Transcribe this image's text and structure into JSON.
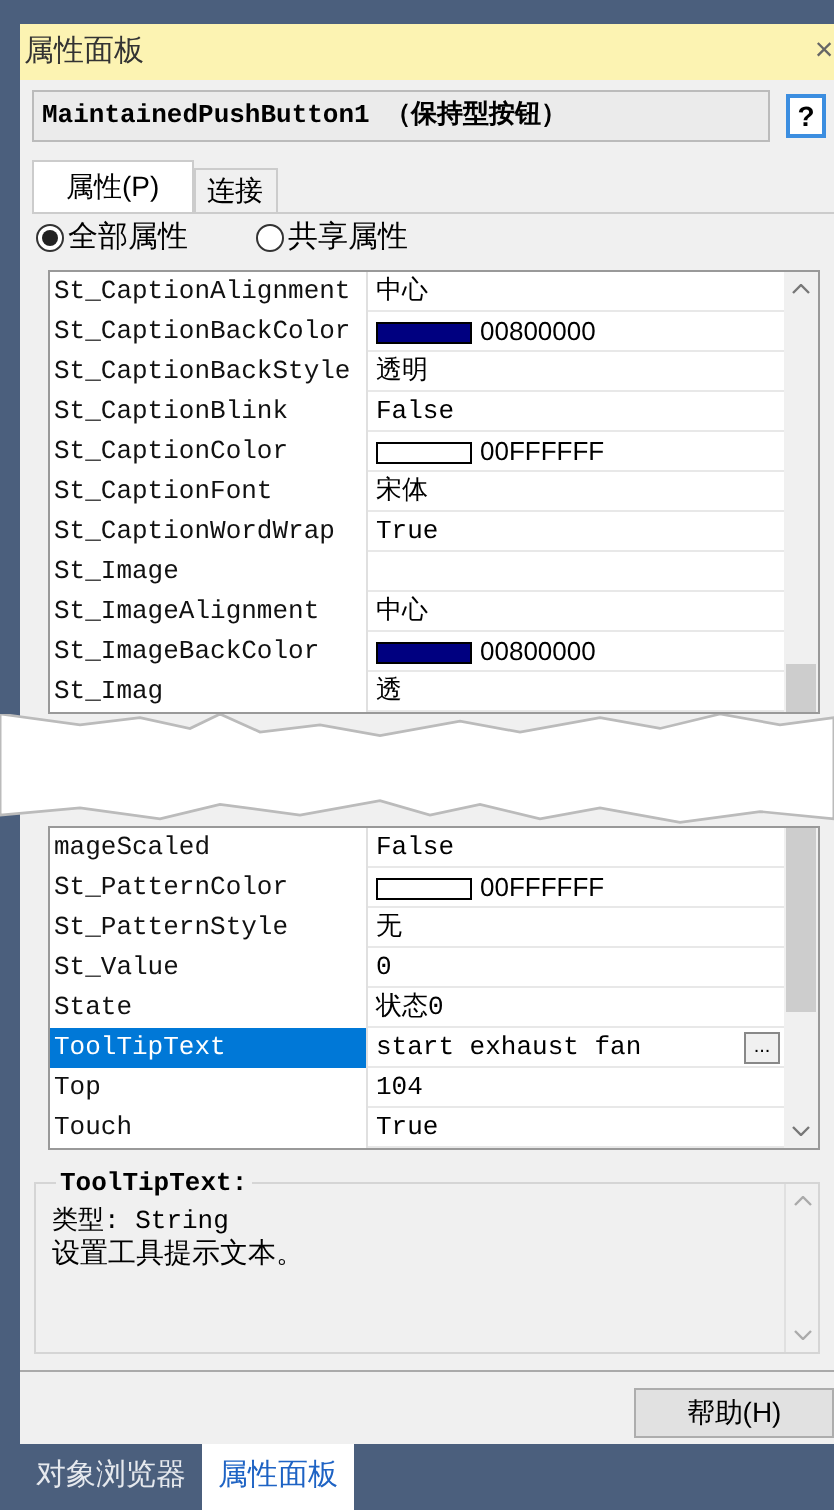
{
  "window": {
    "title": "属性面板",
    "close": "×"
  },
  "object": {
    "label": "MaintainedPushButton1 （保持型按钮）",
    "help": "?"
  },
  "tabs": [
    {
      "label": "属性(P)",
      "selected": true
    },
    {
      "label": "连接",
      "selected": false
    }
  ],
  "filters": [
    {
      "label": "全部属性",
      "selected": true
    },
    {
      "label": "共享属性",
      "selected": false
    }
  ],
  "grid": {
    "upper_rows": [
      {
        "name": "St_CaptionAlignment",
        "kind": "text",
        "value": "中心",
        "selected": false
      },
      {
        "name": "St_CaptionBackColor",
        "kind": "color",
        "color": "#000080",
        "value": "00800000",
        "selected": false
      },
      {
        "name": "St_CaptionBackStyle",
        "kind": "text",
        "value": "透明",
        "selected": false
      },
      {
        "name": "St_CaptionBlink",
        "kind": "text",
        "value": "False",
        "selected": false
      },
      {
        "name": "St_CaptionColor",
        "kind": "color",
        "color": "#ffffff",
        "value": "00FFFFFF",
        "selected": false
      },
      {
        "name": "St_CaptionFont",
        "kind": "text",
        "value": "宋体",
        "selected": false
      },
      {
        "name": "St_CaptionWordWrap",
        "kind": "text",
        "value": "True",
        "selected": false
      },
      {
        "name": "St_Image",
        "kind": "text",
        "selected": false
      },
      {
        "name": "St_ImageAlignment",
        "kind": "text",
        "value": "中心",
        "selected": false
      },
      {
        "name": "St_ImageBackColor",
        "kind": "color",
        "color": "#000080",
        "value": "00800000",
        "selected": false
      },
      {
        "name": "St_Imag",
        "kind": "text",
        "value": "透",
        "selected": false
      }
    ],
    "lower_rows": [
      {
        "name": "mageScaled",
        "kind": "text",
        "value": "False",
        "selected": false
      },
      {
        "name": "St_PatternColor",
        "kind": "color",
        "color": "#ffffff",
        "value": "00FFFFFF",
        "selected": false
      },
      {
        "name": "St_PatternStyle",
        "kind": "text",
        "value": "无",
        "selected": false
      },
      {
        "name": "St_Value",
        "kind": "text",
        "value": "0",
        "selected": false
      },
      {
        "name": "State",
        "kind": "text",
        "value": "状态0",
        "selected": false
      },
      {
        "name": "ToolTipText",
        "kind": "text",
        "value": "start exhaust fan",
        "button": "...",
        "selected": true
      },
      {
        "name": "Top",
        "kind": "text",
        "value": "104",
        "selected": false
      },
      {
        "name": "Touch",
        "kind": "text",
        "value": "True",
        "selected": false
      }
    ]
  },
  "description": {
    "title": "ToolTipText:",
    "type_line": "类型: String",
    "text": "设置工具提示文本。"
  },
  "help_button": "帮助(H)",
  "bottom_tabs": [
    {
      "label": "对象浏览器",
      "selected": false
    },
    {
      "label": "属性面板",
      "selected": true
    }
  ]
}
